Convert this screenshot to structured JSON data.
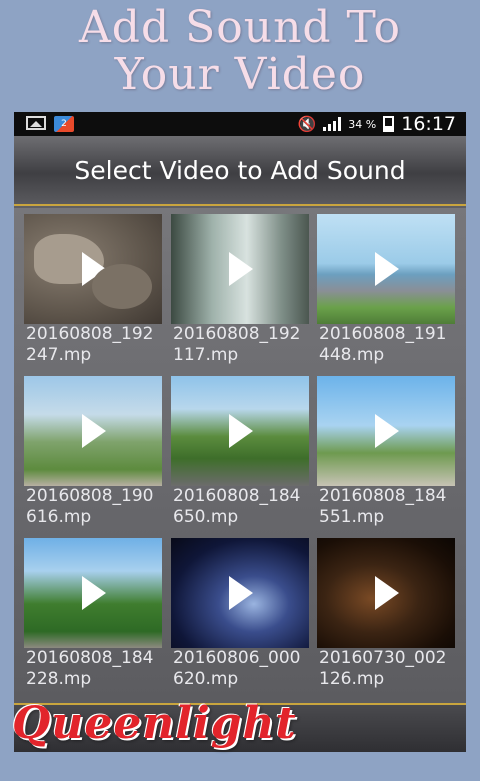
{
  "promo": {
    "title_line1": "Add Sound To",
    "title_line2": "Your Video"
  },
  "statusbar": {
    "battery_pct": "34 %",
    "time": "16:17",
    "icons": [
      "image-icon",
      "app-icon",
      "mute-icon",
      "signal-icon",
      "battery-icon"
    ]
  },
  "appbar": {
    "title": "Select Video to Add Sound"
  },
  "videos": [
    {
      "filename": "20160808_192247.mp"
    },
    {
      "filename": "20160808_192117.mp"
    },
    {
      "filename": "20160808_191448.mp"
    },
    {
      "filename": "20160808_190616.mp"
    },
    {
      "filename": "20160808_184650.mp"
    },
    {
      "filename": "20160808_184551.mp"
    },
    {
      "filename": "20160808_184228.mp"
    },
    {
      "filename": "20160806_000620.mp"
    },
    {
      "filename": "20160730_002126.mp"
    }
  ],
  "brand": {
    "logo_text": "Queenlight"
  },
  "colors": {
    "background": "#8ea3c4",
    "title_text": "#f6dde8",
    "accent_border": "#c9a53e",
    "logo_red": "#e2242b"
  }
}
